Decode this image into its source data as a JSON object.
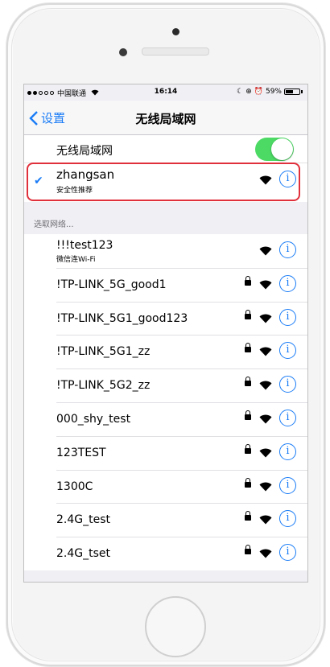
{
  "statusbar": {
    "carrier": "中国联通",
    "time": "16:14",
    "battery": "59%",
    "battery_level": 0.59
  },
  "nav": {
    "back_label": "设置",
    "title": "无线局域网"
  },
  "wlan": {
    "label": "无线局域网",
    "enabled": true,
    "toggle_color": "#4cd964"
  },
  "connected": {
    "name": "zhangsan",
    "subtitle": "安全性推荐"
  },
  "choose_header": "选取网络...",
  "networks": [
    {
      "name": "!!!test123",
      "subtitle": "微信连Wi-Fi",
      "locked": false
    },
    {
      "name": "!TP-LINK_5G_good1",
      "locked": true
    },
    {
      "name": "!TP-LINK_5G1_good123",
      "locked": true
    },
    {
      "name": "!TP-LINK_5G1_zz",
      "locked": true
    },
    {
      "name": "!TP-LINK_5G2_zz",
      "locked": true
    },
    {
      "name": "000_shy_test",
      "locked": true
    },
    {
      "name": "123TEST",
      "locked": true
    },
    {
      "name": "1300C",
      "locked": true
    },
    {
      "name": "2.4G_test",
      "locked": true
    },
    {
      "name": "2.4G_tset",
      "locked": true
    }
  ],
  "colors": {
    "accent": "#1a7cf6",
    "highlight": "#e0303c"
  },
  "icons": [
    "back-chevron-icon",
    "checkmark-icon",
    "wifi-icon",
    "lock-icon",
    "info-icon"
  ]
}
